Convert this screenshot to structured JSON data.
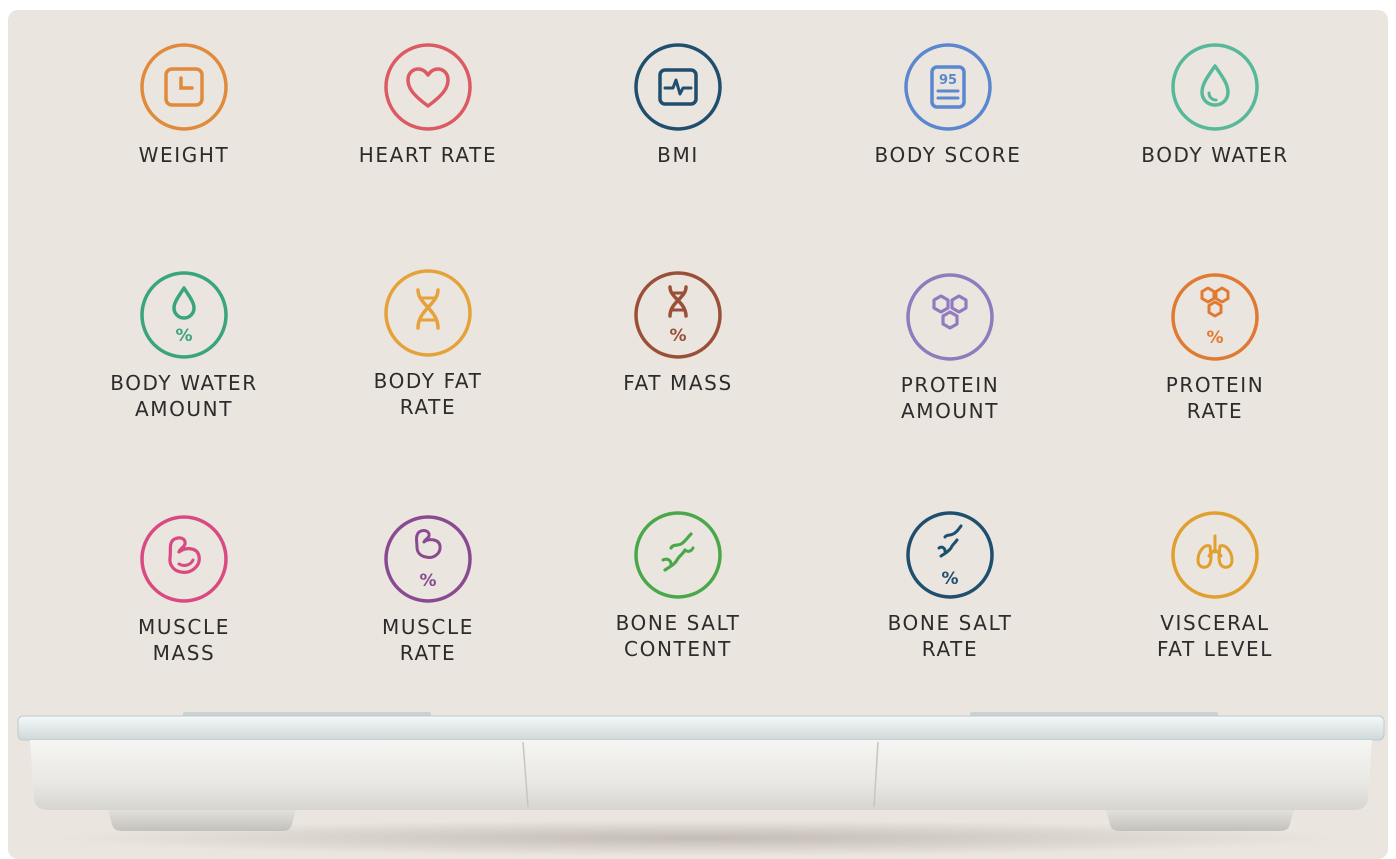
{
  "metrics": [
    {
      "label": "WEIGHT",
      "icon": "weight-scale-icon",
      "color": "#e08a3c"
    },
    {
      "label": "HEART RATE",
      "icon": "heart-icon",
      "color": "#dc5a62"
    },
    {
      "label": "BMI",
      "icon": "bmi-pulse-icon",
      "color": "#1f4f6e"
    },
    {
      "label": "BODY SCORE",
      "icon": "score-clipboard-icon",
      "color": "#5b87cf"
    },
    {
      "label": "BODY WATER",
      "icon": "water-drop-icon",
      "color": "#57b89a"
    },
    {
      "label": "BODY WATER\nAMOUNT",
      "icon": "water-drop-percent-icon",
      "color": "#3aa47a"
    },
    {
      "label": "BODY FAT\nRATE",
      "icon": "dna-icon",
      "color": "#e6a23a"
    },
    {
      "label": "FAT MASS",
      "icon": "dna-percent-icon",
      "color": "#9a5038"
    },
    {
      "label": "PROTEIN\nAMOUNT",
      "icon": "hexagon-molecule-icon",
      "color": "#8f7bbd"
    },
    {
      "label": "PROTEIN\nRATE",
      "icon": "hexagon-molecule-percent-icon",
      "color": "#e07a32"
    },
    {
      "label": "MUSCLE\nMASS",
      "icon": "muscle-arm-icon",
      "color": "#d94a82"
    },
    {
      "label": "MUSCLE\nRATE",
      "icon": "muscle-arm-percent-icon",
      "color": "#8a4a92"
    },
    {
      "label": "BONE SALT\nCONTENT",
      "icon": "bone-joint-icon",
      "color": "#4aa84a"
    },
    {
      "label": "BONE SALT\nRATE",
      "icon": "bone-joint-percent-icon",
      "color": "#1f4f6e"
    },
    {
      "label": "VISCERAL\nFAT LEVEL",
      "icon": "lungs-icon",
      "color": "#e0a030"
    }
  ],
  "percent_symbol": "%",
  "score_value": "95"
}
